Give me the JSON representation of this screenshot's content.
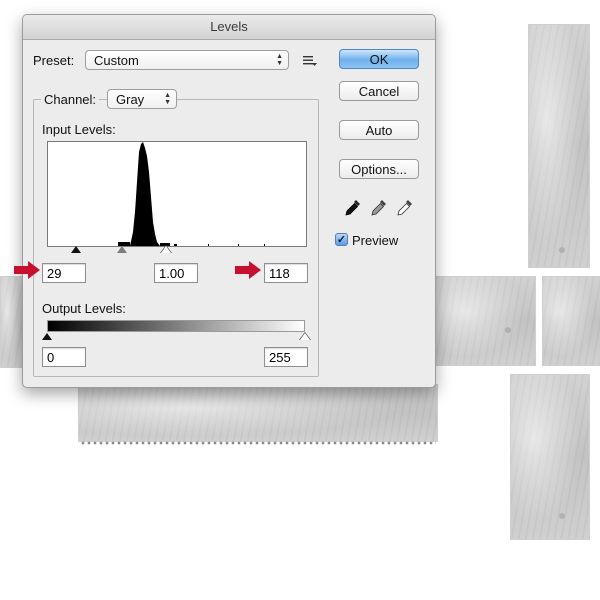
{
  "window": {
    "title": "Levels"
  },
  "preset": {
    "label": "Preset:",
    "value": "Custom"
  },
  "buttons": {
    "ok": "OK",
    "cancel": "Cancel",
    "auto": "Auto",
    "options": "Options..."
  },
  "channel": {
    "label": "Channel:",
    "value": "Gray"
  },
  "input_levels": {
    "label": "Input Levels:",
    "black": "29",
    "gamma": "1.00",
    "white": "118",
    "black_fraction": 0.114,
    "gamma_fraction": 0.29,
    "white_fraction": 0.463
  },
  "output_levels": {
    "label": "Output Levels:",
    "black": "0",
    "white": "255",
    "black_fraction": 0.0,
    "white_fraction": 1.0
  },
  "preview": {
    "label": "Preview",
    "checked": true
  },
  "icons": {
    "preset_menu": "preset-options-icon",
    "eyedroppers": [
      "black-point-eyedropper-icon",
      "gray-point-eyedropper-icon",
      "white-point-eyedropper-icon"
    ],
    "annotation_arrows": "red-arrow-icon"
  },
  "colors": {
    "default_button": "#6fb1ee",
    "annotation_arrow": "#c8102e"
  }
}
